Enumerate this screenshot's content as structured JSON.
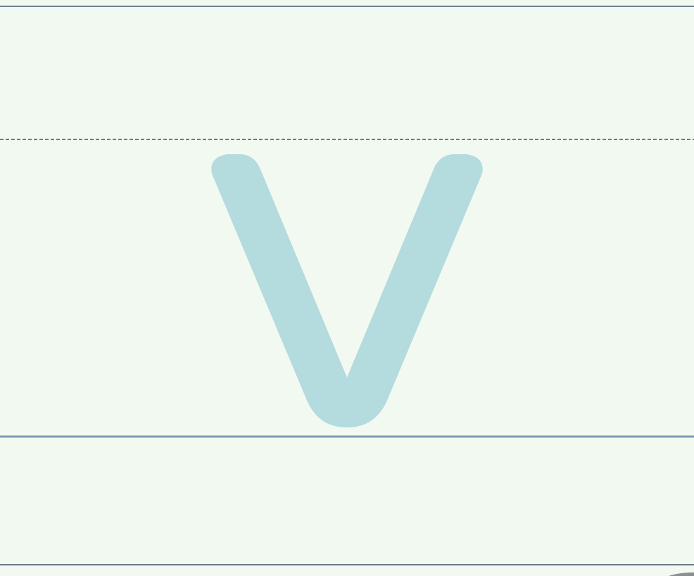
{
  "worksheet": {
    "letter": "v",
    "colors": {
      "background": "#f2f9f0",
      "letter_fill": "#b4dbde",
      "top_line": "#6f8291",
      "mid_dashed_line": "#6f7a86",
      "base_line": "#7d9bb2",
      "bottom_line": "#6d7d86",
      "corner_mark": "#8a8f92"
    }
  }
}
